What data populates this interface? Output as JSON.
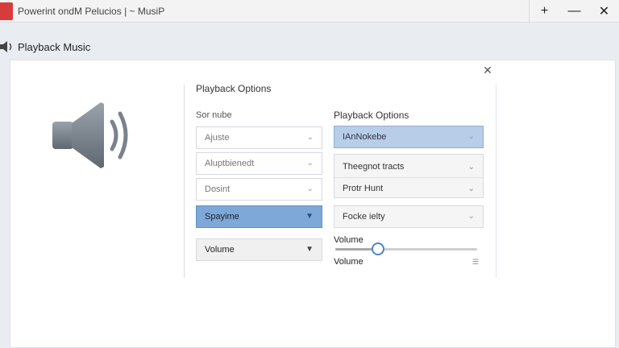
{
  "window": {
    "title": "Powerint ondM Pelucios  |  ~  MusiP",
    "controls": {
      "new": "+",
      "minimize": "—",
      "close": "✕"
    }
  },
  "header": {
    "title": "Playback Music"
  },
  "panel": {
    "close_glyph": "✕",
    "left_section": {
      "title": "Playback Options",
      "sub_label": "Sor nube",
      "dropdowns": [
        {
          "value": "Ajuste"
        },
        {
          "value": "Aluptbienedt"
        },
        {
          "value": "Dosint"
        },
        {
          "value": "Spayime"
        },
        {
          "value": "Volume"
        }
      ]
    },
    "right_section": {
      "title": "Playback Options",
      "dropdowns": [
        {
          "value": "IAnNokebe"
        },
        {
          "value": "Theegnot tracts"
        },
        {
          "value": "Protr Hunt"
        },
        {
          "value": "Focke ielty"
        }
      ],
      "volume": {
        "label_top": "Volume",
        "label_bottom": "Volume",
        "level": 0.3,
        "icon": "list-icon"
      }
    }
  },
  "colors": {
    "accent": "#4a86c5",
    "selected": "#7ea8d8",
    "logo": "#d83b3b"
  }
}
